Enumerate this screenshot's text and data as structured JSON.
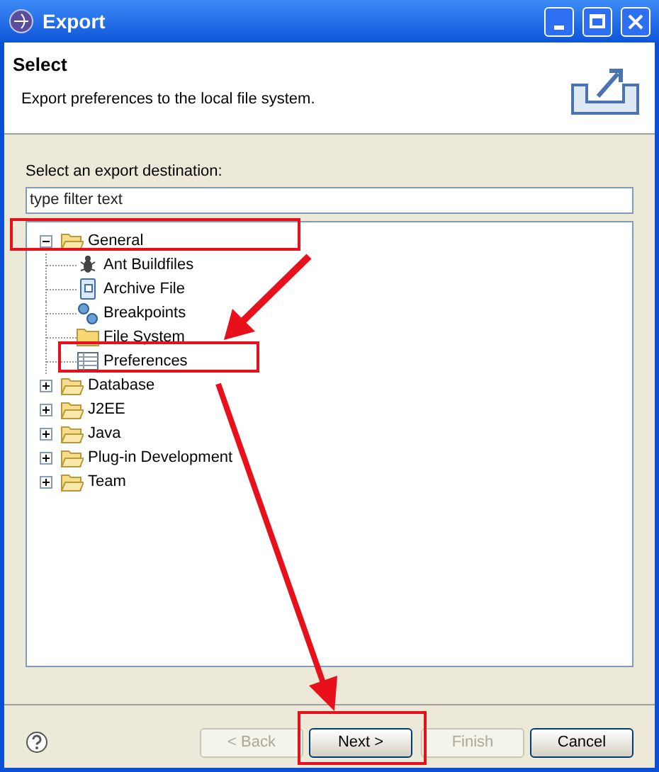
{
  "window": {
    "title": "Export"
  },
  "header": {
    "title": "Select",
    "description": "Export preferences to the local file system."
  },
  "destination_label": "Select an export destination:",
  "filter": {
    "placeholder": "type filter text"
  },
  "tree": [
    {
      "label": "General",
      "expanded": true,
      "children": [
        {
          "label": "Ant Buildfiles"
        },
        {
          "label": "Archive File"
        },
        {
          "label": "Breakpoints"
        },
        {
          "label": "File System"
        },
        {
          "label": "Preferences"
        }
      ]
    },
    {
      "label": "Database",
      "expanded": false
    },
    {
      "label": "J2EE",
      "expanded": false
    },
    {
      "label": "Java",
      "expanded": false
    },
    {
      "label": "Plug-in Development",
      "expanded": false
    },
    {
      "label": "Team",
      "expanded": false
    }
  ],
  "buttons": [
    {
      "label": "< Back",
      "disabled": true
    },
    {
      "label": "Next >",
      "disabled": false
    },
    {
      "label": "Finish",
      "disabled": true
    },
    {
      "label": "Cancel",
      "disabled": false
    }
  ]
}
